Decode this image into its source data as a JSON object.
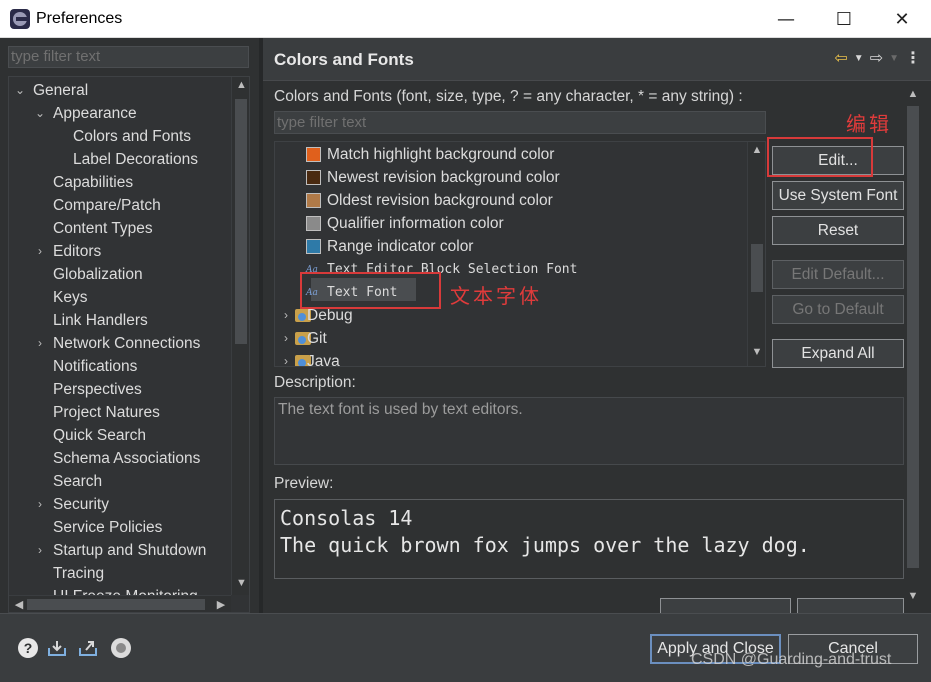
{
  "window": {
    "title": "Preferences",
    "minimize": "—",
    "maximize": "☐",
    "close": "✕"
  },
  "left": {
    "filter_placeholder": "type filter text",
    "tree": [
      {
        "label": "General",
        "chevron": "⌄",
        "indent": 0
      },
      {
        "label": "Appearance",
        "chevron": "⌄",
        "indent": 1
      },
      {
        "label": "Colors and Fonts",
        "chevron": "",
        "indent": 2
      },
      {
        "label": "Label Decorations",
        "chevron": "",
        "indent": 2
      },
      {
        "label": "Capabilities",
        "chevron": "",
        "indent": 1
      },
      {
        "label": "Compare/Patch",
        "chevron": "",
        "indent": 1
      },
      {
        "label": "Content Types",
        "chevron": "",
        "indent": 1
      },
      {
        "label": "Editors",
        "chevron": "›",
        "indent": 1
      },
      {
        "label": "Globalization",
        "chevron": "",
        "indent": 1
      },
      {
        "label": "Keys",
        "chevron": "",
        "indent": 1
      },
      {
        "label": "Link Handlers",
        "chevron": "",
        "indent": 1
      },
      {
        "label": "Network Connections",
        "chevron": "›",
        "indent": 1
      },
      {
        "label": "Notifications",
        "chevron": "",
        "indent": 1
      },
      {
        "label": "Perspectives",
        "chevron": "",
        "indent": 1
      },
      {
        "label": "Project Natures",
        "chevron": "",
        "indent": 1
      },
      {
        "label": "Quick Search",
        "chevron": "",
        "indent": 1
      },
      {
        "label": "Schema Associations",
        "chevron": "",
        "indent": 1
      },
      {
        "label": "Search",
        "chevron": "",
        "indent": 1
      },
      {
        "label": "Security",
        "chevron": "›",
        "indent": 1
      },
      {
        "label": "Service Policies",
        "chevron": "",
        "indent": 1
      },
      {
        "label": "Startup and Shutdown",
        "chevron": "›",
        "indent": 1
      },
      {
        "label": "Tracing",
        "chevron": "",
        "indent": 1
      },
      {
        "label": "UI Freeze Monitoring",
        "chevron": "",
        "indent": 1
      }
    ]
  },
  "right": {
    "title": "Colors and Fonts",
    "section_label": "Colors and Fonts (font, size, type, ? = any character, * = any string) :",
    "filter_placeholder": "type filter text",
    "color_tree": [
      {
        "label": "Match highlight background color",
        "kind": "swatch",
        "color": "#e0601c"
      },
      {
        "label": "Newest revision background color",
        "kind": "swatch",
        "color": "#4a2a10"
      },
      {
        "label": "Oldest revision background color",
        "kind": "swatch",
        "color": "#b07a48"
      },
      {
        "label": "Qualifier information color",
        "kind": "swatch",
        "color": "#8a8a8a"
      },
      {
        "label": "Range indicator color",
        "kind": "swatch",
        "color": "#2e7aa8"
      },
      {
        "label": "Text Editor Block Selection Font",
        "kind": "font"
      },
      {
        "label": "Text Font",
        "kind": "font"
      },
      {
        "label": "Debug",
        "kind": "folder"
      },
      {
        "label": "Git",
        "kind": "folder"
      },
      {
        "label": "Java",
        "kind": "folder"
      }
    ],
    "buttons": {
      "edit": "Edit...",
      "use_system_font": "Use System Font",
      "reset": "Reset",
      "edit_default": "Edit Default...",
      "go_to_default": "Go to Default",
      "expand_all": "Expand All"
    },
    "description_label": "Description:",
    "description": "The text font is used by text editors.",
    "preview_label": "Preview:",
    "preview_lines": [
      "Consolas 14",
      "The quick brown fox jumps over the lazy dog."
    ]
  },
  "annotations": {
    "edit": "编辑",
    "text_font": "文本字体",
    "color": "#d83a3a"
  },
  "footer": {
    "apply_close": "Apply and Close",
    "cancel": "Cancel"
  },
  "watermark": "CSDN @Guarding-and-trust"
}
